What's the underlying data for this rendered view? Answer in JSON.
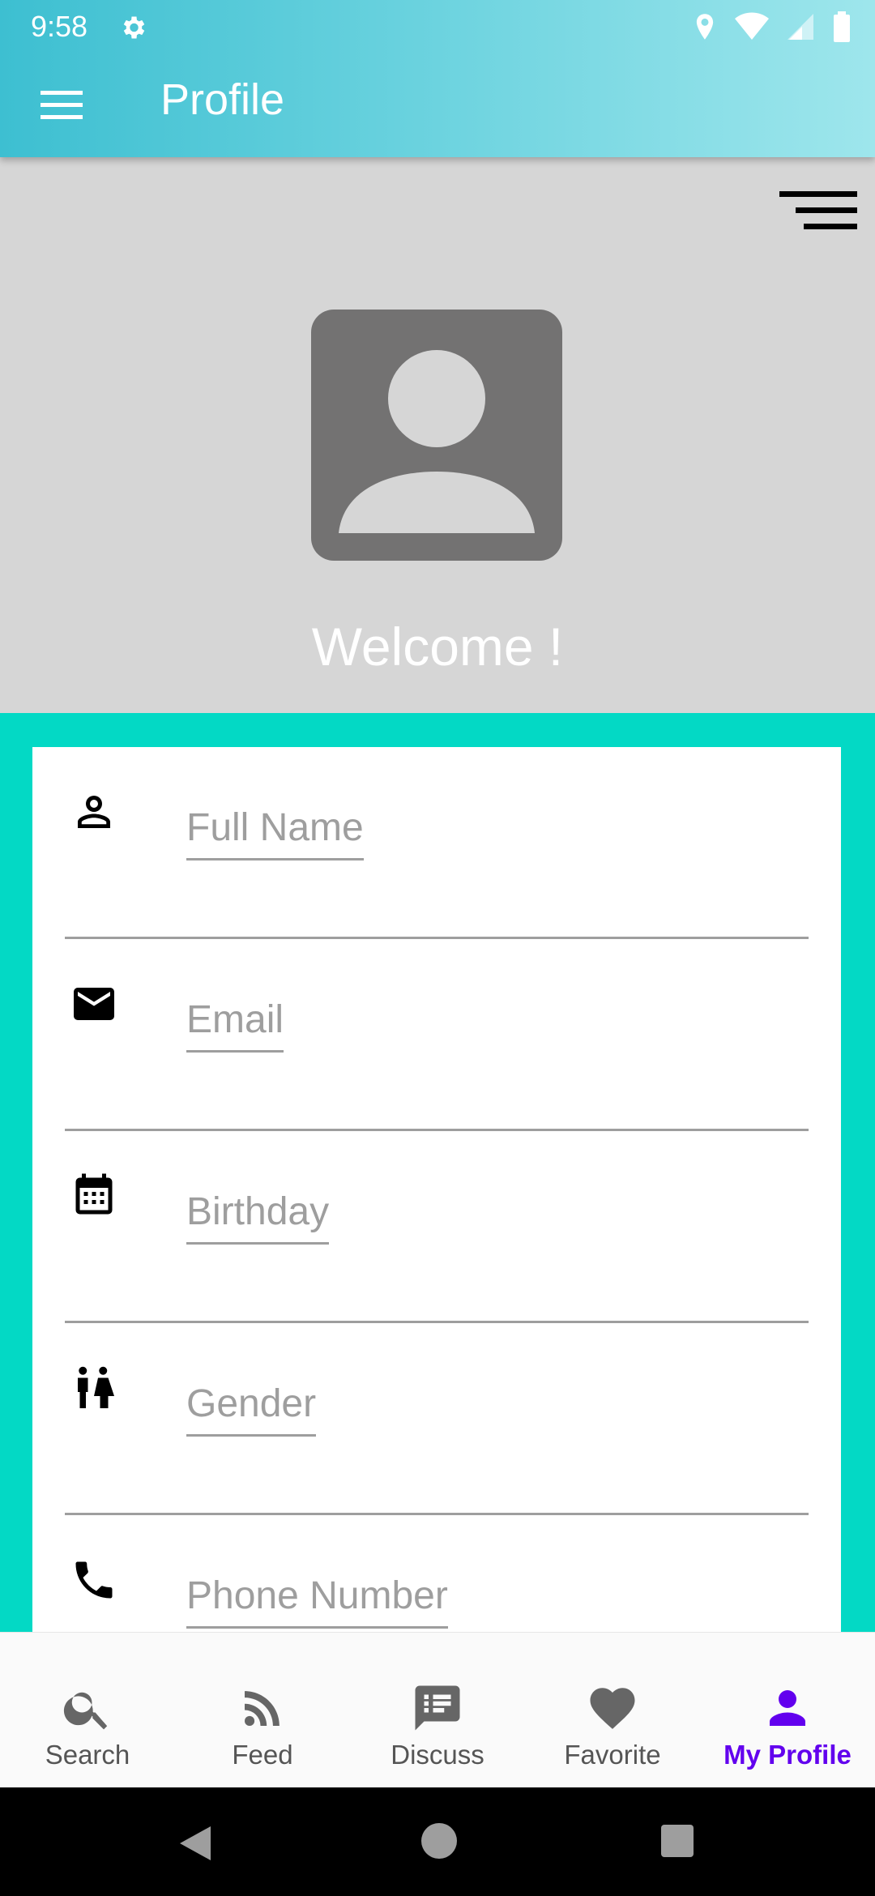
{
  "status": {
    "time": "9:58"
  },
  "appbar": {
    "title": "Profile"
  },
  "header": {
    "welcome": "Welcome !"
  },
  "form": {
    "fields": [
      {
        "placeholder": "Full Name",
        "icon": "person-outline-icon"
      },
      {
        "placeholder": "Email",
        "icon": "mail-icon"
      },
      {
        "placeholder": "Birthday",
        "icon": "calendar-icon"
      },
      {
        "placeholder": "Gender",
        "icon": "wc-icon"
      },
      {
        "placeholder": "Phone Number",
        "icon": "phone-icon"
      }
    ]
  },
  "bottom_nav": {
    "items": [
      {
        "label": "Search",
        "icon": "search-icon",
        "active": false
      },
      {
        "label": "Feed",
        "icon": "rss-feed-icon",
        "active": false
      },
      {
        "label": "Discuss",
        "icon": "discuss-icon",
        "active": false
      },
      {
        "label": "Favorite",
        "icon": "heart-icon",
        "active": false
      },
      {
        "label": "My Profile",
        "icon": "profile-icon",
        "active": true
      }
    ]
  },
  "colors": {
    "accent_active": "#6200ee",
    "form_background": "#03d9c5",
    "header_background": "#d6d6d6",
    "avatar": "#737272"
  }
}
